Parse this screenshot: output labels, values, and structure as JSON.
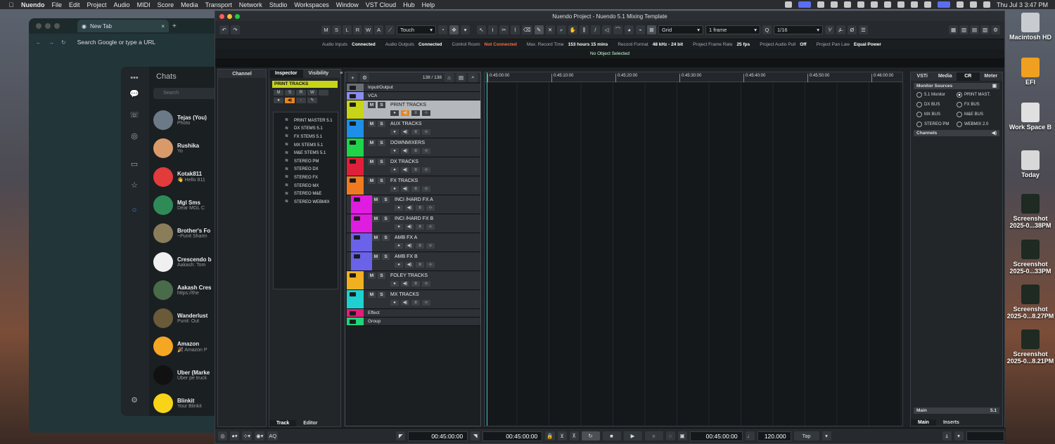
{
  "menubar": {
    "app": "Nuendo",
    "items": [
      "File",
      "Edit",
      "Project",
      "Audio",
      "MIDI",
      "Score",
      "Media",
      "Transport",
      "Network",
      "Studio",
      "Workspaces",
      "Window",
      "VST Cloud",
      "Hub",
      "Help"
    ],
    "clock": "Thu Jul 3  3:47 PM"
  },
  "chrome": {
    "tab": "New Tab",
    "url": "Search Google or type a URL"
  },
  "chats": {
    "title": "Chats",
    "search": "Search",
    "items": [
      {
        "name": "Tejas (You)",
        "msg": "Photo",
        "color": "#6b7a86"
      },
      {
        "name": "Rushika",
        "msg": "Yo",
        "color": "#d99a6a"
      },
      {
        "name": "Kotak811",
        "msg": "👋 Hello 811",
        "color": "#e23b3b"
      },
      {
        "name": "Mgl Sms",
        "msg": "Dear MGL C",
        "color": "#2e8b57"
      },
      {
        "name": "Brother's Fo",
        "msg": "~Punit Sharm",
        "color": "#8a7d5a"
      },
      {
        "name": "Crescendo b",
        "msg": "Aakash: Tom",
        "color": "#f0f0f0"
      },
      {
        "name": "Aakash Cres",
        "msg": "https://the",
        "color": "#4a6b4a"
      },
      {
        "name": "Wanderlust",
        "msg": "Punit: Out",
        "color": "#6a5a3a"
      },
      {
        "name": "Amazon",
        "msg": "🎉 Amazon P",
        "color": "#f5a623"
      },
      {
        "name": "Uber (Marke",
        "msg": "Uber pe truck",
        "color": "#111111"
      },
      {
        "name": "Blinkit",
        "msg": "Your Blinkit",
        "color": "#f7d417"
      }
    ]
  },
  "nuendo": {
    "title": "Nuendo Project - Nuendo 5.1 Mixing Template",
    "toolbar": {
      "buttons": [
        "M",
        "S",
        "L",
        "R",
        "W",
        "A"
      ],
      "automation": "Touch",
      "snap": "Grid",
      "quantize_frame": "1 frame",
      "quantize": "1/16"
    },
    "status": [
      {
        "label": "Audio Inputs",
        "value": "Connected",
        "red": false
      },
      {
        "label": "Audio Outputs",
        "value": "Connected",
        "red": false
      },
      {
        "label": "Control Room",
        "value": "Not Connected",
        "red": true
      },
      {
        "label": "Max. Record Time",
        "value": "153 hours 15 mins",
        "red": false
      },
      {
        "label": "Record Format",
        "value": "48 kHz - 24 bit",
        "red": false
      },
      {
        "label": "Project Frame Rate",
        "value": "25 fps",
        "red": false
      },
      {
        "label": "Project Audio Pull",
        "value": "Off",
        "red": false
      },
      {
        "label": "Project Pan Law",
        "value": "Equal Power",
        "red": false
      }
    ],
    "info": "No Object Selected",
    "channel_tab": "Channel",
    "inspector": {
      "tabs": [
        "Inspector",
        "Visibility"
      ],
      "selected": "PRINT TRACKS",
      "mini": [
        "M",
        "S",
        "R",
        "W"
      ],
      "subtracks": [
        "PRINT MASTER 5.1",
        "DX STEMS 5.1",
        "FX STEMS 5.1",
        "MX STEMS 5.1",
        "M&E STEMS 5.1",
        "STEREO PM",
        "STEREO DX",
        "STEREO FX",
        "STEREO MX",
        "STEREO M&E",
        "STEREO WEBMIX"
      ],
      "bottom_tabs": [
        "Track",
        "Editor"
      ]
    },
    "tracklist": {
      "count": "138 / 138",
      "rows": [
        {
          "name": "Input/Output",
          "color": "#6a6f75",
          "h": 12,
          "slim": true
        },
        {
          "name": "VCA",
          "color": "#8a8ef0",
          "h": 12,
          "slim": true
        },
        {
          "name": "PRINT TRACKS",
          "color": "#c8d417",
          "h": 27,
          "sel": true
        },
        {
          "name": "AUX TRACKS",
          "color": "#1f8ee8",
          "h": 27
        },
        {
          "name": "DOWNMIXERS",
          "color": "#1fd44a",
          "h": 27
        },
        {
          "name": "DX TRACKS",
          "color": "#e0203a",
          "h": 27
        },
        {
          "name": "FX TRACKS",
          "color": "#f07a20",
          "h": 27
        },
        {
          "name": "INCI /HARD FX A",
          "color": "#e01ce0",
          "h": 27,
          "indent": true
        },
        {
          "name": "INCI /HARD FX B",
          "color": "#e01ce0",
          "h": 27,
          "indent": true
        },
        {
          "name": "AMB FX A",
          "color": "#6a62e8",
          "h": 27,
          "indent": true
        },
        {
          "name": "AMB FX B",
          "color": "#6a62e8",
          "h": 27,
          "indent": true
        },
        {
          "name": "FOLEY TRACKS",
          "color": "#f0b020",
          "h": 27
        },
        {
          "name": "MX TRACKS",
          "color": "#1fd0d0",
          "h": 27
        },
        {
          "name": "Effect",
          "color": "#e0207a",
          "h": 12,
          "slim": true
        },
        {
          "name": "Group",
          "color": "#1fd47a",
          "h": 12,
          "slim": true
        }
      ]
    },
    "ruler": [
      "0:45:00:00",
      "0:45:10:00",
      "0:45:20:00",
      "0:45:30:00",
      "0:45:40:00",
      "0:45:50:00",
      "0:46:00:00"
    ],
    "right": {
      "tabs": [
        "VSTi",
        "Media",
        "CR",
        "Meter"
      ],
      "active": "CR",
      "monitor": "Monitor Sources",
      "sources": [
        {
          "label": "5.1 Monitor",
          "on": false
        },
        {
          "label": "PRINT MAST.",
          "on": true
        },
        {
          "label": "DX BUS",
          "on": false
        },
        {
          "label": "FX BUS",
          "on": false
        },
        {
          "label": "MX BUS",
          "on": false
        },
        {
          "label": "M&E BUS",
          "on": false
        },
        {
          "label": "STEREO PM",
          "on": false
        },
        {
          "label": "WEBMIX 2.0",
          "on": false
        }
      ],
      "channels": "Channels",
      "main": "Main",
      "main_val": "5.1",
      "bottom_tabs": [
        "Main",
        "Inserts"
      ]
    },
    "transport": {
      "aq": "AQ",
      "tc1": "00:45:00:00",
      "tc2": "00:45:00:00",
      "tc3": "00:45:00:00",
      "tempo": "120.000",
      "tap": "Tap"
    }
  },
  "dock": [
    {
      "label": "Macintosh HD",
      "color": "#c8ccd0"
    },
    {
      "label": "EFI",
      "color": "#f0a020"
    },
    {
      "label": "Work Space B",
      "color": "#e0e0e0"
    },
    {
      "label": "Today",
      "color": "#d8d8d8"
    },
    {
      "label": "Screenshot\n2025-0...38PM",
      "color": "#1e2a22"
    },
    {
      "label": "Screenshot\n2025-0...33PM",
      "color": "#1e2a22"
    },
    {
      "label": "Screenshot\n2025-0...8.27PM",
      "color": "#1e2a22"
    },
    {
      "label": "Screenshot\n2025-0...8.21PM",
      "color": "#1e2a22"
    }
  ]
}
